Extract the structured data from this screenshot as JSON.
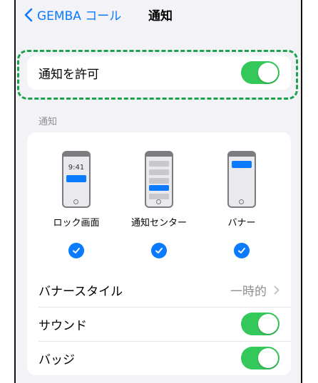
{
  "nav": {
    "back_label": "GEMBA コール",
    "title": "通知"
  },
  "allow": {
    "label": "通知を許可",
    "enabled": true
  },
  "section": {
    "label": "通知"
  },
  "styles": [
    {
      "label": "ロック画面",
      "checked": true,
      "preview_time": "9:41"
    },
    {
      "label": "通知センター",
      "checked": true
    },
    {
      "label": "バナー",
      "checked": true
    }
  ],
  "banner_style": {
    "label": "バナースタイル",
    "value": "一時的"
  },
  "sound": {
    "label": "サウンド",
    "enabled": true
  },
  "badge": {
    "label": "バッジ",
    "enabled": true
  },
  "colors": {
    "accent": "#0a7aff",
    "toggle_on": "#34c759",
    "highlight": "#1aa34a"
  },
  "icons": {
    "back": "chevron-left-icon",
    "disclosure": "chevron-right-icon",
    "check": "checkmark-icon"
  }
}
